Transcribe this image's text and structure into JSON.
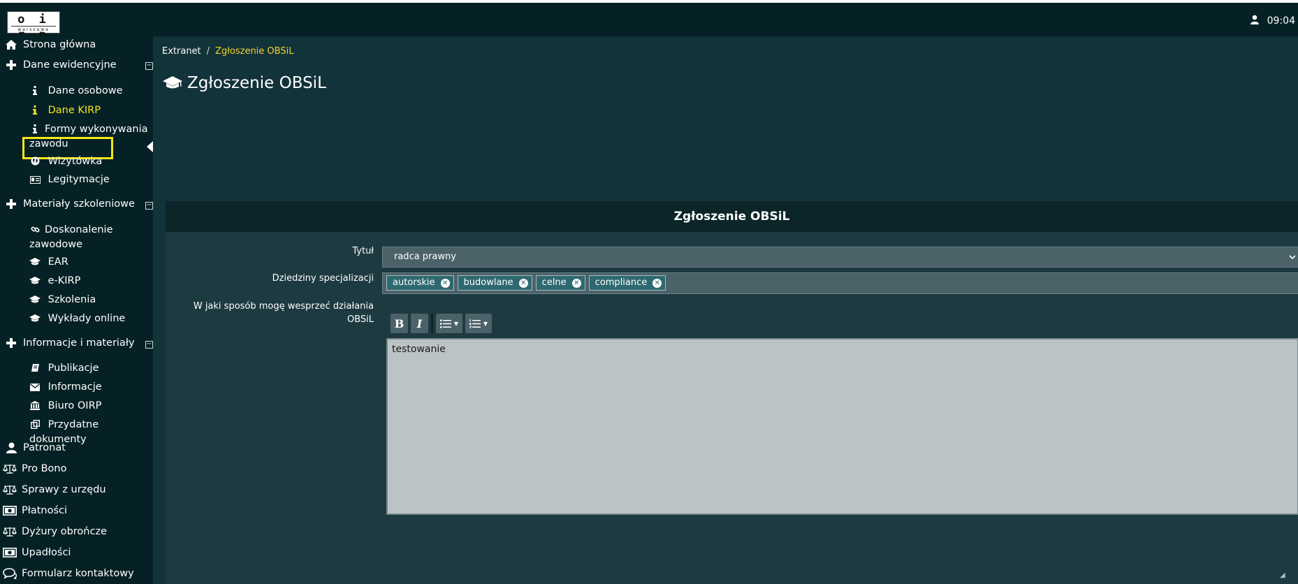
{
  "topbar": {
    "logo": {
      "letters": "o i r p",
      "subtitle": "warszawa"
    },
    "clock": "09:04",
    "user_icon": "user-icon"
  },
  "sidebar": {
    "items": [
      {
        "label": "Strona główna",
        "icon": "home-icon"
      },
      {
        "label": "Dane ewidencyjne",
        "icon": "plus-icon",
        "collapse": "⊟"
      },
      {
        "label": "Materiały szkoleniowe",
        "icon": "plus-icon",
        "collapse": "⊟"
      },
      {
        "label": "Informacje i materiały",
        "icon": "plus-icon",
        "collapse": "⊟"
      },
      {
        "label": "Patronat",
        "icon": "user-icon"
      },
      {
        "label": "Pro Bono",
        "icon": "scales-icon"
      },
      {
        "label": "Sprawy z urzędu",
        "icon": "scales-icon"
      },
      {
        "label": "Płatności",
        "icon": "money-icon"
      },
      {
        "label": "Dyżury obrończe",
        "icon": "scales-icon"
      },
      {
        "label": "Upadłości",
        "icon": "money-icon"
      },
      {
        "label": "Formularz kontaktowy",
        "icon": "comments-icon"
      }
    ],
    "sub_dane": [
      {
        "label": "Dane osobowe",
        "icon": "info-icon"
      },
      {
        "label": "Dane KIRP",
        "icon": "info-icon",
        "active": true
      },
      {
        "label": "Formy wykonywania zawodu",
        "icon": "info-icon"
      },
      {
        "label": "Wizytówka",
        "icon": "globe-icon"
      },
      {
        "label": "Legitymacje",
        "icon": "id-card-icon"
      }
    ],
    "sub_materialy": [
      {
        "label": "Doskonalenie zawodowe",
        "icon": "link-icon"
      },
      {
        "label": "EAR",
        "icon": "graduation-cap-icon"
      },
      {
        "label": "e-KIRP",
        "icon": "graduation-cap-icon"
      },
      {
        "label": "Szkolenia",
        "icon": "graduation-cap-icon"
      },
      {
        "label": "Wykłady online",
        "icon": "graduation-cap-icon"
      }
    ],
    "sub_informacje": [
      {
        "label": "Publikacje",
        "icon": "book-icon"
      },
      {
        "label": "Informacje",
        "icon": "envelope-icon"
      },
      {
        "label": "Biuro OIRP",
        "icon": "bank-icon"
      },
      {
        "label": "Przydatne dokumenty",
        "icon": "copy-icon"
      }
    ],
    "active_color": "#f5e71a"
  },
  "breadcrumb": {
    "root": "Extranet",
    "separator": "/",
    "current": "Zgłoszenie OBSiL"
  },
  "page_title": "Zgłoszenie OBSiL",
  "form": {
    "header": "Zgłoszenie OBSiL",
    "title_label": "Tytuł",
    "title_value": "radca prawny",
    "spec_label": "Dziedziny specjalizacji",
    "spec_tags": [
      "autorskie",
      "budowlane",
      "celne",
      "compliance"
    ],
    "support_label_line1": "W jaki sposób mogę wesprzeć działania",
    "support_label_line2": "OBSiL",
    "toolbar": {
      "bold": "B",
      "italic": "I"
    },
    "support_value": "testowanie"
  },
  "colors": {
    "sidebar_bg": "#062126",
    "main_bg": "#123339",
    "panel_bg": "#1d3a40",
    "breadcrumb_active": "#f5d12a"
  }
}
